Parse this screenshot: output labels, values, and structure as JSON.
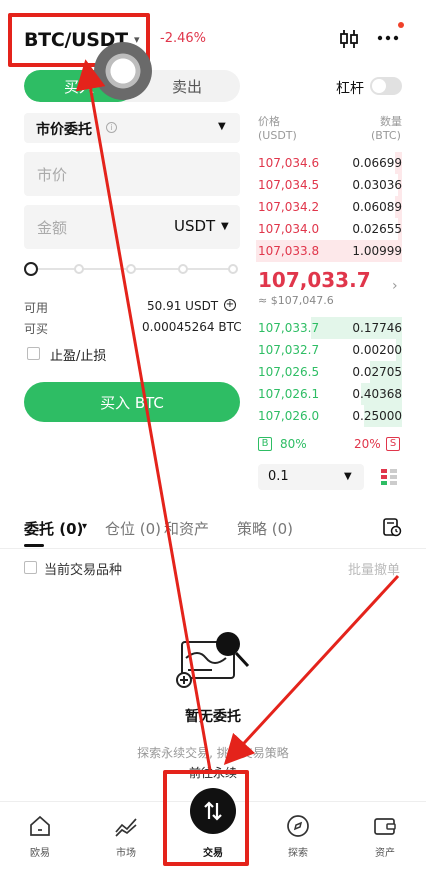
{
  "header": {
    "pair": "BTC/USDT",
    "change": "-2.46%"
  },
  "trade_tabs": {
    "buy": "买入",
    "sell": "卖出"
  },
  "leverage": {
    "label": "杠杆",
    "enabled": false
  },
  "order_form": {
    "order_type": "市价委托",
    "price_placeholder": "市价",
    "amount_placeholder": "金额",
    "amount_unit": "USDT",
    "slider_percent": 0,
    "available_label": "可用",
    "available_value": "50.91 USDT",
    "buyable_label": "可买",
    "buyable_value": "0.00045264 BTC",
    "tpsl_label": "止盈/止损",
    "buy_button": "买入 BTC"
  },
  "order_book": {
    "price_header": "价格",
    "price_unit": "(USDT)",
    "qty_header": "数量",
    "qty_unit": "(BTC)",
    "asks": [
      {
        "price": "107,034.6",
        "qty": "0.06699",
        "depth": 0.05
      },
      {
        "price": "107,034.5",
        "qty": "0.03036",
        "depth": 0.03
      },
      {
        "price": "107,034.2",
        "qty": "0.06089",
        "depth": 0.05
      },
      {
        "price": "107,034.0",
        "qty": "0.02655",
        "depth": 0.03
      },
      {
        "price": "107,033.8",
        "qty": "1.00999",
        "depth": 1.0
      }
    ],
    "last_price": "107,033.7",
    "last_price_usd": "≈ $107,047.6",
    "bids": [
      {
        "price": "107,033.7",
        "qty": "0.17746",
        "depth": 0.62
      },
      {
        "price": "107,032.7",
        "qty": "0.00200",
        "depth": 0.04
      },
      {
        "price": "107,026.5",
        "qty": "0.02705",
        "depth": 0.22
      },
      {
        "price": "107,026.1",
        "qty": "0.40368",
        "depth": 0.28
      },
      {
        "price": "107,026.0",
        "qty": "0.25000",
        "depth": 0.26
      }
    ],
    "buy_ratio": "80%",
    "sell_ratio": "20%",
    "buy_letter": "B",
    "sell_letter": "S",
    "depth_value": "0.1"
  },
  "order_tabs": {
    "open": "委托 (0)",
    "positions": "仓位 (0)",
    "assets": "和资产",
    "strategy": "策略 (0)"
  },
  "filters": {
    "current_pair": "当前交易品种",
    "batch_cancel": "批量撤单"
  },
  "empty_state": {
    "title": "暂无委托",
    "desc": "探索永续交易, 挑战交易策略",
    "link": "前往永续"
  },
  "nav": [
    {
      "label": "欧易",
      "icon": "home-icon"
    },
    {
      "label": "市场",
      "icon": "chart-icon"
    },
    {
      "label": "交易",
      "icon": "trade-icon"
    },
    {
      "label": "探索",
      "icon": "compass-icon"
    },
    {
      "label": "资产",
      "icon": "wallet-icon"
    }
  ],
  "colors": {
    "buy": "#2ebd64",
    "sell": "#e0364b",
    "annotation": "#e4231b"
  }
}
